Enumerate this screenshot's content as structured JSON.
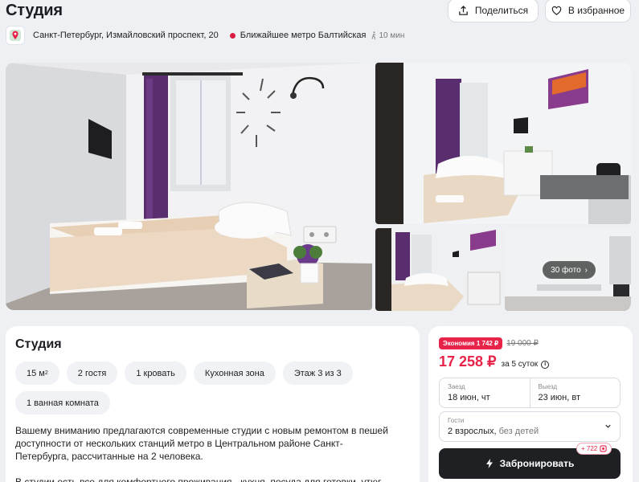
{
  "header": {
    "title": "Студия",
    "share_label": "Поделиться",
    "favorite_label": "В избранное",
    "address": "Санкт-Петербург, Измайловский проспект, 20",
    "metro": "Ближайшее метро Балтийская",
    "walk_time": "10 мин"
  },
  "gallery": {
    "more_label": "30 фото"
  },
  "details": {
    "title": "Студия",
    "chips": {
      "area": "15 м",
      "area_sup": "2",
      "guests": "2 гостя",
      "beds": "1 кровать",
      "kitchen": "Кухонная зона",
      "floor": "Этаж 3 из 3",
      "bathroom": "1 ванная комната"
    },
    "paragraph1": "Вашему вниманию предлагаются современные студии с новым ремонтом в пешей доступности от нескольких станций метро в Центральном районе Санкт-Петербурга, рассчитанные на 2 человека.",
    "paragraph2": "В студии есть все для комфортного проживания - кухня, посуда для готовки, утюг"
  },
  "booking": {
    "discount": "Экономия 1 742 ₽",
    "old_price": "19 000 ₽",
    "price": "17 258 ₽",
    "price_note": "за 5 суток",
    "checkin_label": "Заезд",
    "checkin_value": "18 июн, чт",
    "checkout_label": "Выезд",
    "checkout_value": "23 июн, вт",
    "guests_label": "Гости",
    "guests_adults": "2 взрослых,",
    "guests_children": "без детей",
    "book_label": "Забронировать",
    "bonus": "+ 722"
  },
  "colors": {
    "accent": "#e8234a",
    "dark_button": "#1e2024",
    "background": "#eef0f4"
  },
  "icons": [
    "share-icon",
    "heart-icon",
    "map-pin-icon",
    "metro-dot-icon",
    "walk-icon",
    "chevron-right-icon",
    "info-icon",
    "chevron-down-icon",
    "lightning-icon",
    "bonus-icon"
  ]
}
